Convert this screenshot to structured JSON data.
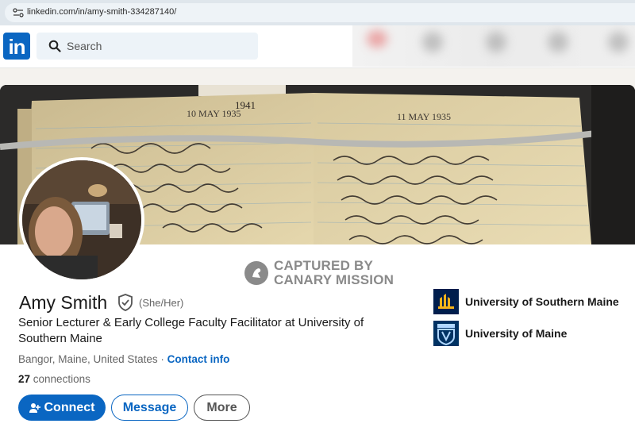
{
  "browser": {
    "url": "linkedin.com/in/amy-smith-334287140/"
  },
  "header": {
    "logo_text": "in",
    "search_placeholder": "Search"
  },
  "cover": {
    "left_page_header": "10 MAY 1935",
    "left_page_year": "1941",
    "right_page_header": "11 MAY 1935"
  },
  "watermark": {
    "line1": "CAPTURED BY",
    "line2": "CANARY MISSION"
  },
  "profile": {
    "name": "Amy Smith",
    "pronouns": "(She/Her)",
    "headline": "Senior Lecturer & Early College Faculty Facilitator at University of Southern Maine",
    "location": "Bangor, Maine, United States",
    "separator": " · ",
    "contact_info": "Contact info",
    "connections_count": "27",
    "connections_label": " connections"
  },
  "actions": {
    "connect": "Connect",
    "message": "Message",
    "more": "More"
  },
  "education": [
    {
      "name": "University of Southern Maine",
      "logo_color": "#001e4d"
    },
    {
      "name": "University of Maine",
      "logo_color": "#003263"
    }
  ],
  "colors": {
    "brand": "#0a66c2",
    "text": "#191919",
    "muted": "#666666"
  }
}
